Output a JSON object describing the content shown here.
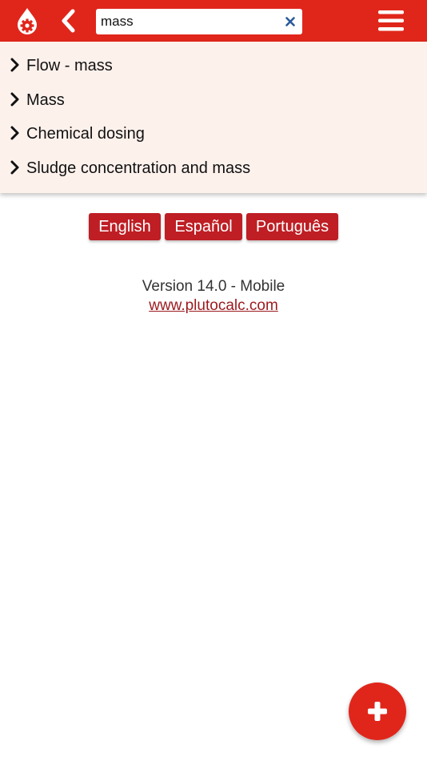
{
  "search": {
    "value": "mass"
  },
  "icons": {
    "logo": "drop-gear-logo-icon",
    "back": "chevron-left-icon",
    "clear": "close-icon",
    "menu": "hamburger-menu-icon",
    "result": "chevron-right-icon",
    "fab": "plus-icon"
  },
  "results": [
    {
      "label": "Flow - mass"
    },
    {
      "label": "Mass"
    },
    {
      "label": "Chemical dosing"
    },
    {
      "label": "Sludge concentration and mass"
    }
  ],
  "languages": [
    {
      "label": "English"
    },
    {
      "label": "Español"
    },
    {
      "label": "Português"
    }
  ],
  "footer": {
    "version": "Version 14.0 - Mobile",
    "site": "www.plutocalc.com"
  },
  "colors": {
    "primary": "#e0261b",
    "button": "#be1e24",
    "panel": "#fdf1ec",
    "link": "#9b1a1e",
    "clear_icon": "#2a5a9a"
  }
}
